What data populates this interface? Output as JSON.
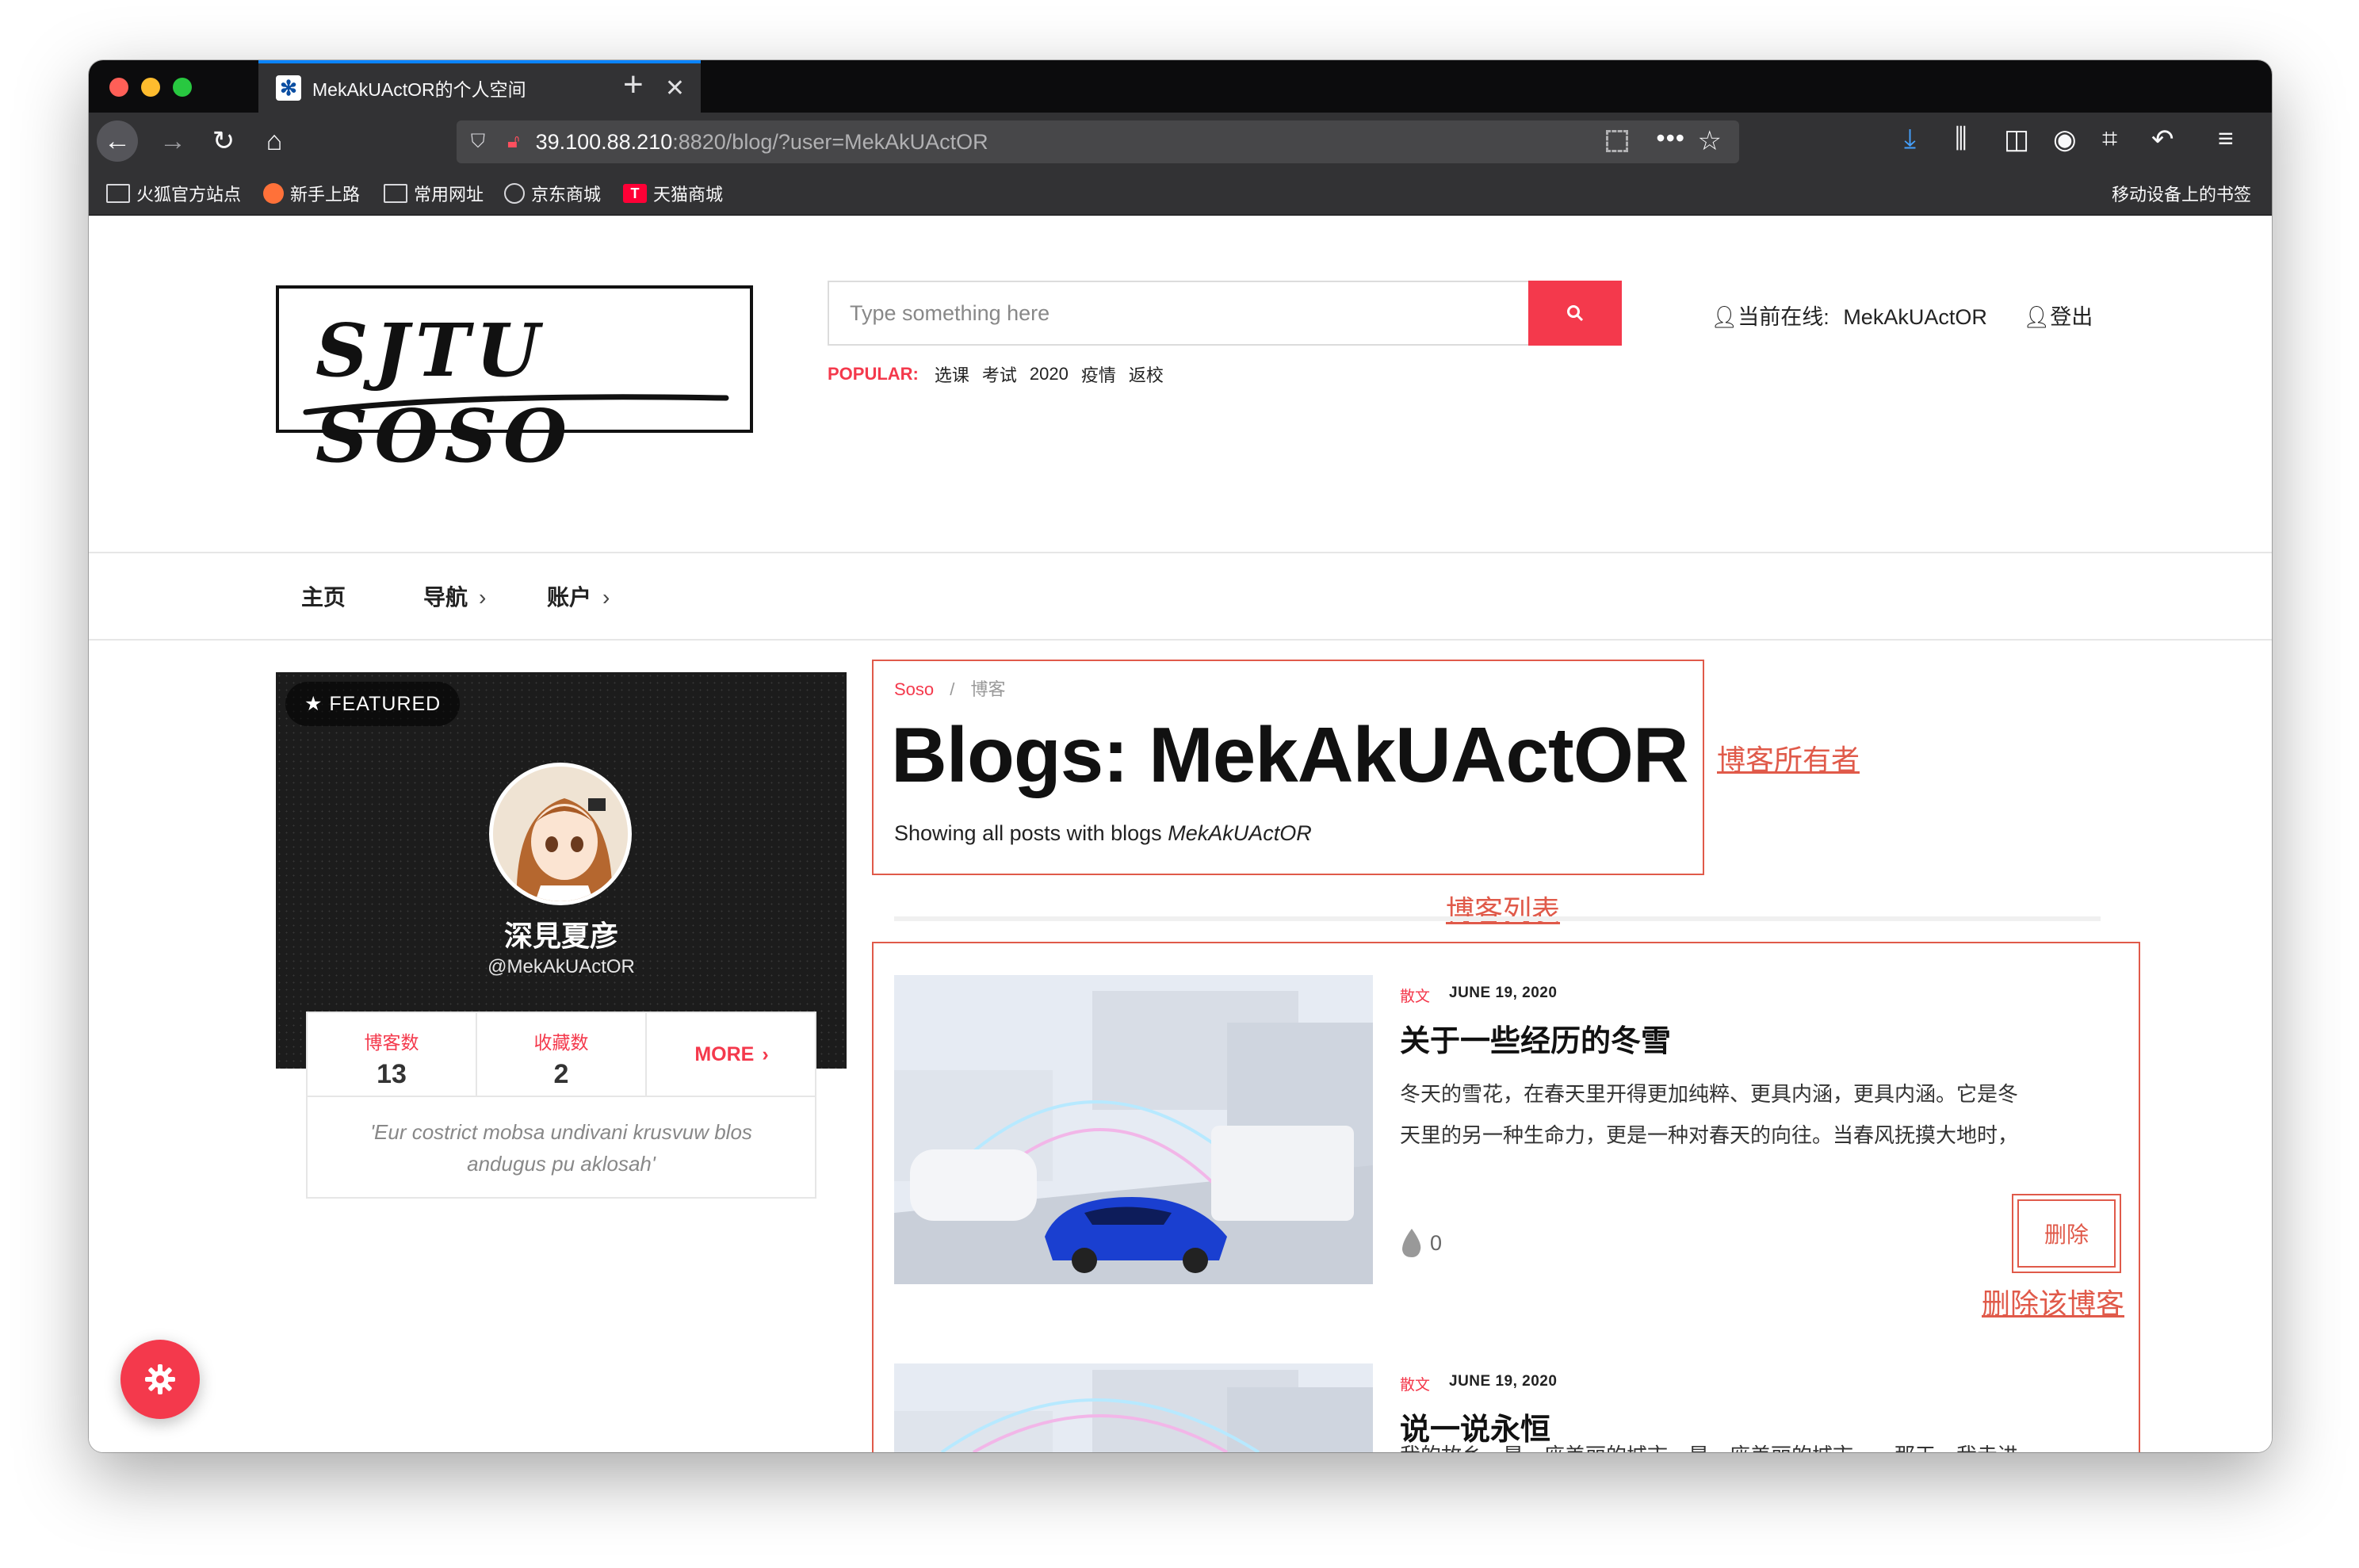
{
  "browser": {
    "tab_title": "MekAkUActOR的个人空间",
    "url_host": "39.100.88.210",
    "url_rest": ":8820/blog/?user=MekAkUActOR",
    "bookmarks": [
      "火狐官方站点",
      "新手上路",
      "常用网址",
      "京东商城",
      "天猫商城"
    ],
    "mobile_bookmarks": "移动设备上的书签"
  },
  "header": {
    "logo_text": "SJTU SOSO",
    "search_placeholder": "Type something here",
    "popular_label": "POPULAR:",
    "popular_tags": [
      "选课",
      "考试",
      "2020",
      "疫情",
      "返校"
    ],
    "online_label": "当前在线:",
    "online_user": "MekAkUActOR",
    "logout": "登出"
  },
  "menu": {
    "home": "主页",
    "nav": "导航",
    "account": "账户"
  },
  "profile": {
    "featured": "★ FEATURED",
    "name": "深見夏彦",
    "handle": "@MekAkUActOR",
    "stats": [
      {
        "label": "博客数",
        "value": "13"
      },
      {
        "label": "收藏数",
        "value": "2"
      }
    ],
    "more": "MORE",
    "quote": "'Eur costrict mobsa undivani krusvuw blos andugus pu aklosah'"
  },
  "main": {
    "breadcrumb": [
      "Soso",
      "博客"
    ],
    "title": "Blogs: MekAkUActOR",
    "showing_prefix": "Showing all posts with blogs",
    "showing_user": "MekAkUActOR"
  },
  "annotations": {
    "owner": "博客所有者",
    "list": "博客列表",
    "delete": "删除该博客"
  },
  "posts": [
    {
      "category": "散文",
      "date": "JUNE 19, 2020",
      "title": "关于一些经历的冬雪",
      "excerpt_1": "冬天的雪花，在春天里开得更加纯粹、更具内涵，更具内涵。它是冬",
      "excerpt_2": "天里的另一种生命力，更是一种对春天的向往。当春风抚摸大地时，",
      "likes": "0",
      "delete": "删除"
    },
    {
      "category": "散文",
      "date": "JUNE 19, 2020",
      "title": "说一说永恒",
      "excerpt_1": "我的故乡，是一座美丽的城市，是一座美丽的城市。一那天，我走进"
    }
  ]
}
